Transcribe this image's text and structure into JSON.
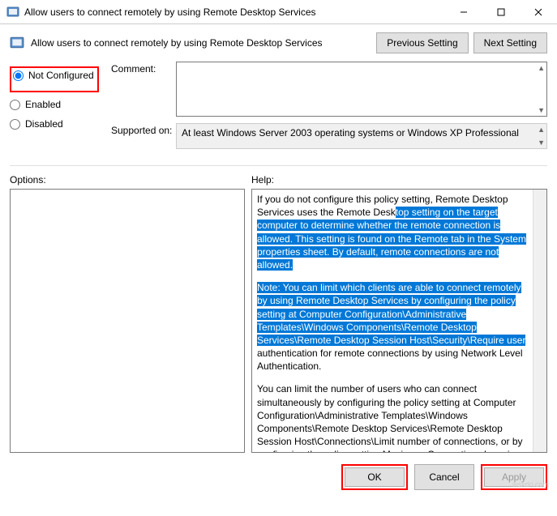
{
  "titlebar": {
    "title": "Allow users to connect remotely by using Remote Desktop Services"
  },
  "header": {
    "title": "Allow users to connect remotely by using Remote Desktop Services",
    "prev_btn": "Previous Setting",
    "next_btn": "Next Setting"
  },
  "radios": {
    "not_configured": "Not Configured",
    "enabled": "Enabled",
    "disabled": "Disabled"
  },
  "fields": {
    "comment_label": "Comment:",
    "comment_value": "",
    "supported_label": "Supported on:",
    "supported_value": "At least Windows Server 2003 operating systems or Windows XP Professional"
  },
  "panels": {
    "options_label": "Options:",
    "help_label": "Help:"
  },
  "help": {
    "p1_a": "If you do not configure this policy setting, Remote Desktop Services uses the Remote Desk",
    "p1_b": "top setting on the target computer to determine whether the remote connection is allowed. This setting is found on the Remote tab in the System properties sheet. By default, remote connections are not allowed.",
    "p2_a": "Note: You can limit which clients are able to connect remotely by using Remote Desktop Services by configuring the policy setting at Computer Configuration\\Administrative Templates\\Windows Components\\Remote Desktop Services\\Remote Desktop Session Host\\Security\\Require user",
    "p2_b": " authentication for remote connections by using Network Level Authentication.",
    "p3": "You can limit the number of users who can connect simultaneously by configuring the policy setting at Computer Configuration\\Administrative Templates\\Windows Components\\Remote Desktop Services\\Remote Desktop Session Host\\Connections\\Limit number of connections, or by configuring the policy setting Maximum Connections by using the Remote Desktop Session Host WMI Provider."
  },
  "footer": {
    "ok": "OK",
    "cancel": "Cancel",
    "apply": "Apply"
  },
  "watermark": "wsxdn.com"
}
